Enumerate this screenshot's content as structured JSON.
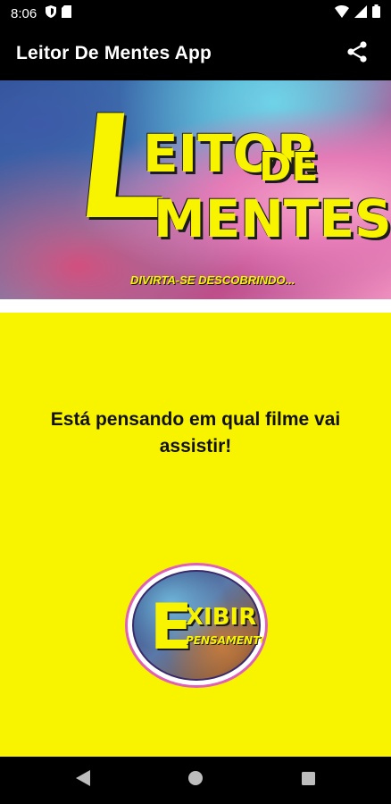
{
  "status_bar": {
    "time": "8:06",
    "left_icons": [
      "shield-icon",
      "sd-card-icon"
    ],
    "right_icons": [
      "wifi-icon",
      "signal-icon",
      "battery-icon"
    ]
  },
  "app_bar": {
    "title": "Leitor De Mentes App",
    "share_icon": "share-icon"
  },
  "banner": {
    "logo_big_letter": "L",
    "logo_word1": "EITOR",
    "logo_word2": "DE",
    "logo_word3": "MENTES",
    "tagline": "DIVIRTA-SE DESCOBRINDO..."
  },
  "main": {
    "message": "Está pensando em qual filme vai assistir!",
    "reveal_button": {
      "big_letter": "E",
      "word1": "XIBIR",
      "word2": "PENSAMENTO"
    }
  },
  "nav_bar": {
    "icons": [
      "back-icon",
      "home-icon",
      "recents-icon"
    ]
  },
  "colors": {
    "accent_yellow": "#f8f400",
    "bar_black": "#000000",
    "button_ring_pink": "#e05fb8"
  }
}
